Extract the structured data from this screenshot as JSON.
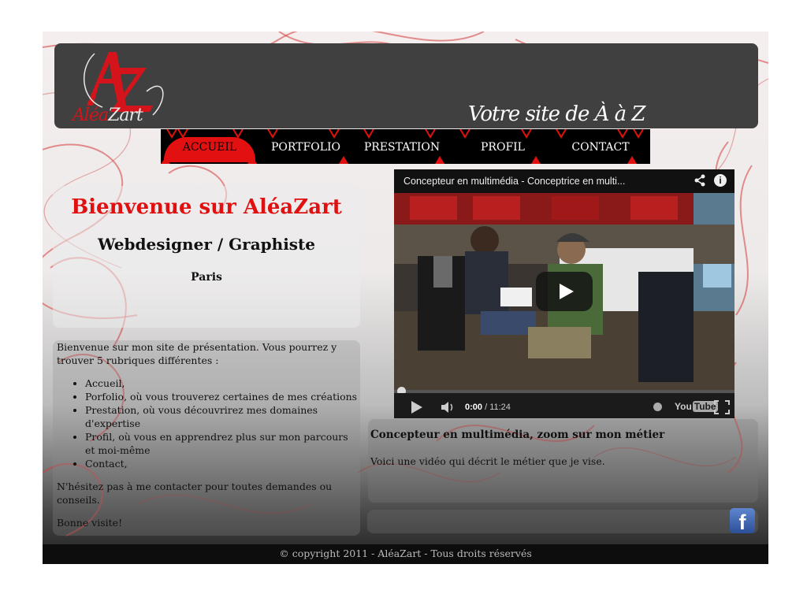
{
  "colors": {
    "accent": "#e01010",
    "header_bg": "#404040",
    "nav_bg": "#000000"
  },
  "logo": {
    "part1": "Aléa",
    "part2": "Zart",
    "icon": "az-monogram-logo"
  },
  "tagline": "Votre site de À à Z",
  "nav": [
    {
      "label": "ACCUEIL",
      "active": true
    },
    {
      "label": "PORTFOLIO",
      "active": false
    },
    {
      "label": "PRESTATION",
      "active": false
    },
    {
      "label": "PROFIL",
      "active": false
    },
    {
      "label": "CONTACT",
      "active": false
    }
  ],
  "welcome": {
    "title": "Bienvenue sur AléaZart",
    "subtitle": "Webdesigner / Graphiste",
    "location": "Paris"
  },
  "intro": {
    "p1": "Bienvenue sur mon site de présentation. Vous pourrez y trouver 5 rubriques différentes :",
    "list": [
      "Accueil,",
      "Porfolio, où vous trouverez certaines de mes créations",
      "Prestation, où vous découvrirez mes domaines d'expertise",
      "Profil, où vous en apprendrez plus sur mon parcours et moi-même",
      "Contact,"
    ],
    "p2": "N'hésitez pas à me contacter pour toutes demandes ou conseils.",
    "p3": "Bonne visite!"
  },
  "video": {
    "title": "Concepteur en multimédia - Conceptrice en multi...",
    "current_time": "0:00",
    "separator": " / ",
    "duration": "11:24",
    "progress": 0,
    "brand": "You",
    "brand2": "Tube"
  },
  "description": {
    "title": "Concepteur en multimédia, zoom sur mon métier",
    "text": "Voici une vidéo qui décrit le métier que je vise."
  },
  "social": {
    "facebook_glyph": "f",
    "icon": "facebook-icon"
  },
  "footer": {
    "text": "© copyright 2011 - AléaZart - Tous droits réservés"
  }
}
